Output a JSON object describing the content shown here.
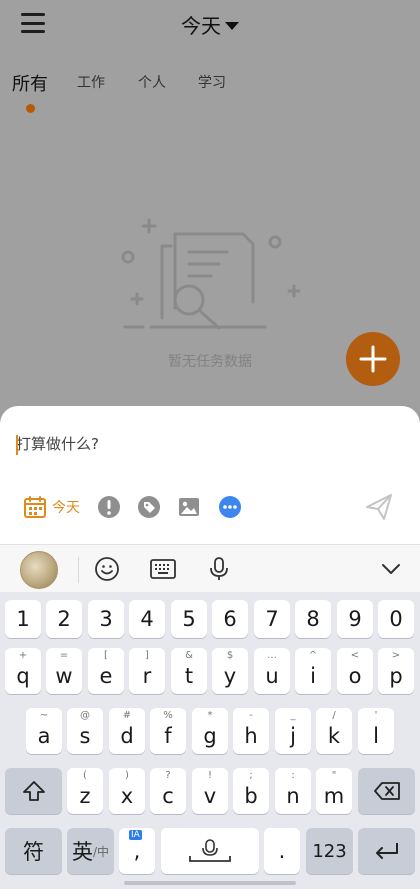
{
  "header": {
    "title": "今天"
  },
  "tabs": [
    {
      "label": "所有"
    },
    {
      "label": "工作"
    },
    {
      "label": "个人"
    },
    {
      "label": "学习"
    }
  ],
  "empty_state": {
    "text": "暂无任务数据"
  },
  "input_sheet": {
    "placeholder": "打算做什么?",
    "date_label": "今天",
    "accent_color": "#e08a1e"
  },
  "keyboard": {
    "number_row": [
      "1",
      "2",
      "3",
      "4",
      "5",
      "6",
      "7",
      "8",
      "9",
      "0"
    ],
    "row1": [
      {
        "main": "q",
        "sub": "+"
      },
      {
        "main": "w",
        "sub": "="
      },
      {
        "main": "e",
        "sub": "["
      },
      {
        "main": "r",
        "sub": "]"
      },
      {
        "main": "t",
        "sub": "&"
      },
      {
        "main": "y",
        "sub": "$"
      },
      {
        "main": "u",
        "sub": "..."
      },
      {
        "main": "i",
        "sub": "^"
      },
      {
        "main": "o",
        "sub": "<"
      },
      {
        "main": "p",
        "sub": ">"
      }
    ],
    "row2": [
      {
        "main": "a",
        "sub": "~"
      },
      {
        "main": "s",
        "sub": "@"
      },
      {
        "main": "d",
        "sub": "#"
      },
      {
        "main": "f",
        "sub": "%"
      },
      {
        "main": "g",
        "sub": "*"
      },
      {
        "main": "h",
        "sub": "-"
      },
      {
        "main": "j",
        "sub": "_"
      },
      {
        "main": "k",
        "sub": "/"
      },
      {
        "main": "l",
        "sub": "'"
      }
    ],
    "row3": [
      {
        "main": "z",
        "sub": "("
      },
      {
        "main": "x",
        "sub": ")"
      },
      {
        "main": "c",
        "sub": "?"
      },
      {
        "main": "v",
        "sub": "!"
      },
      {
        "main": "b",
        "sub": ";"
      },
      {
        "main": "n",
        "sub": ":"
      },
      {
        "main": "m",
        "sub": "\""
      }
    ],
    "symbols_label": "符",
    "lang_label_main": "英",
    "lang_label_sub": "/中",
    "comma_label": ",",
    "ia_badge": "IA",
    "period_label": ".",
    "numbers_label": "123"
  }
}
